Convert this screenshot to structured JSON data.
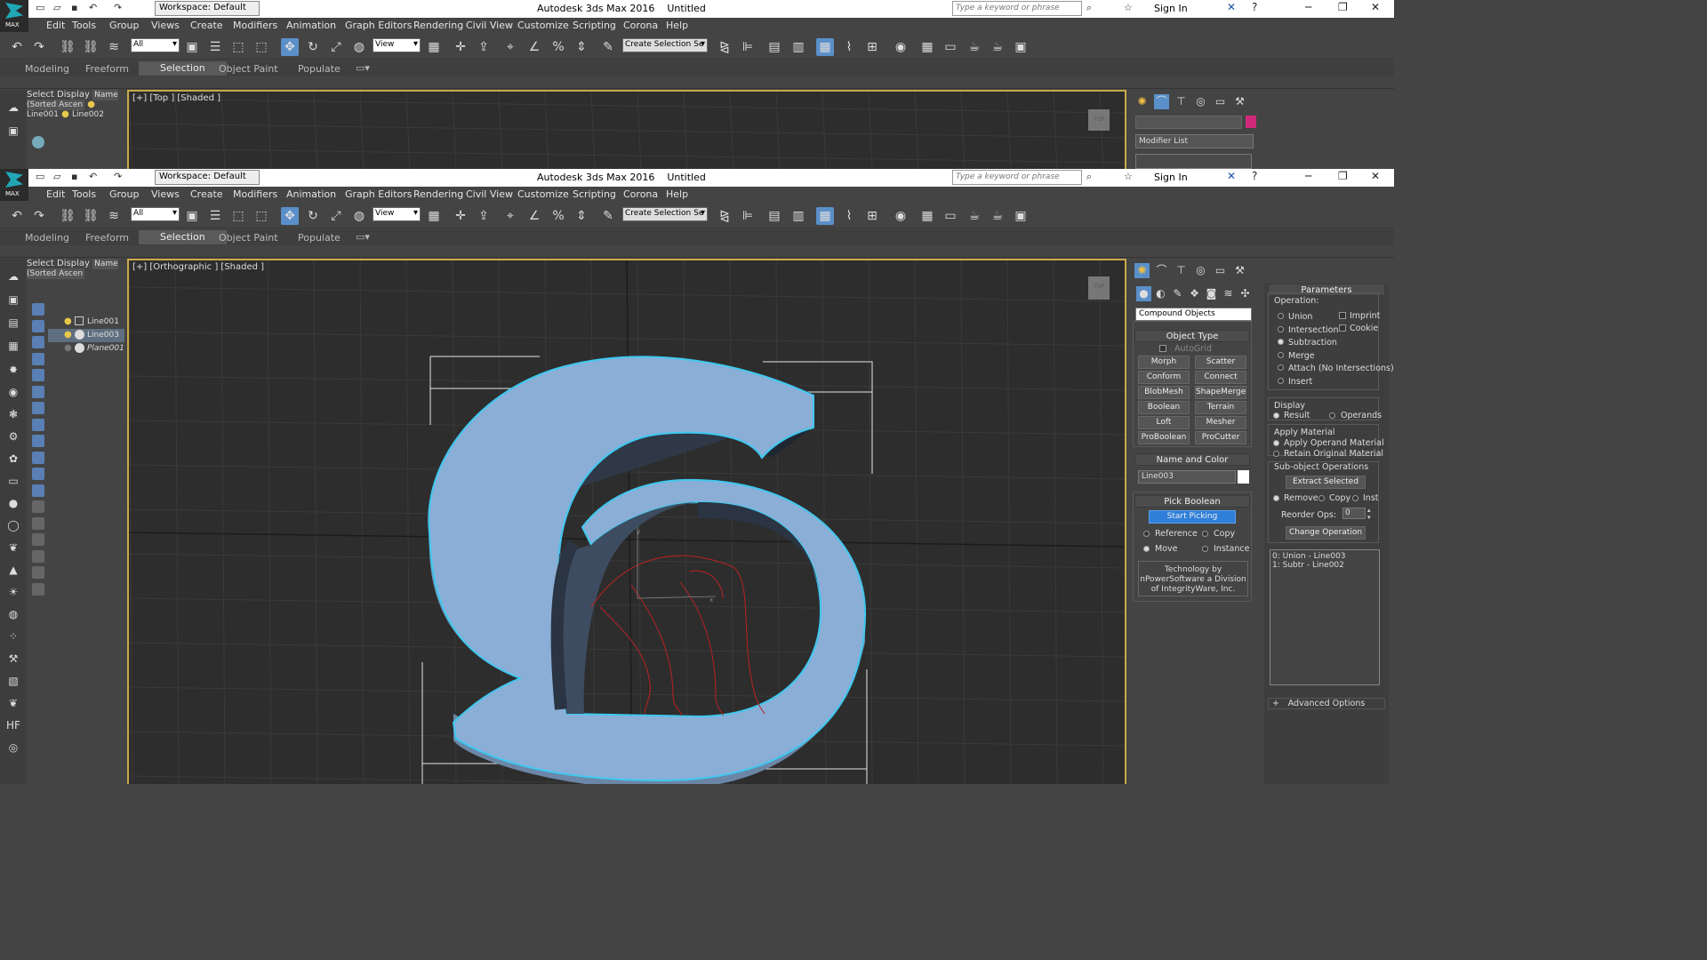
{
  "app": {
    "title": "Autodesk 3ds Max 2016",
    "doc": "Untitled",
    "logo_text": "MAX",
    "workspace": "Workspace: Default",
    "search_placeholder": "Type a keyword or phrase",
    "sign_in": "Sign In"
  },
  "menu": [
    "Edit",
    "Tools",
    "Group",
    "Views",
    "Create",
    "Modifiers",
    "Animation",
    "Graph Editors",
    "Rendering",
    "Civil View",
    "Customize",
    "Scripting",
    "Corona",
    "Help"
  ],
  "toolbar": {
    "filter": "All",
    "refcoord": "View",
    "named_selection": "Create Selection Se"
  },
  "ribbon": {
    "tabs": [
      "Modeling",
      "Freeform",
      "Selection",
      "Object Paint",
      "Populate"
    ],
    "active": "Selection"
  },
  "scene_explorer": {
    "tabs": [
      "Select",
      "Display"
    ],
    "column": "Name (Sorted Ascen",
    "top_items": [
      "Line001",
      "Line002"
    ],
    "items": [
      "Line001",
      "Line003",
      "Plane001"
    ]
  },
  "viewports": {
    "top": "[+] [Top ] [Shaded ]",
    "bottom": "[+] [Orthographic ] [Shaded ]",
    "viewcube": "TOP"
  },
  "modify_top": {
    "modifier_list": "Modifier List",
    "object_color": "#d0287a"
  },
  "create_panel": {
    "category": "Compound Objects",
    "object_type_title": "Object Type",
    "autogrid": "AutoGrid",
    "buttons": [
      "Morph",
      "Scatter",
      "Conform",
      "Connect",
      "BlobMesh",
      "ShapeMerge",
      "Boolean",
      "Terrain",
      "Loft",
      "Mesher",
      "ProBoolean",
      "ProCutter"
    ],
    "name_color_title": "Name and Color",
    "object_name": "Line003",
    "pick_boolean_title": "Pick Boolean",
    "start_picking": "Start Picking",
    "pick_options": [
      "Reference",
      "Copy",
      "Move",
      "Instance"
    ],
    "pick_selected": "Move",
    "credit": [
      "Technology by",
      "nPowerSoftware a Division",
      "of IntegrityWare, Inc."
    ]
  },
  "parameters": {
    "title": "Parameters",
    "operation_label": "Operation:",
    "operations": [
      "Union",
      "Intersection",
      "Subtraction",
      "Merge",
      "Attach (No Intersections)",
      "Insert"
    ],
    "operation_selected": "Subtraction",
    "checks": [
      "Imprint",
      "Cookie"
    ],
    "display_label": "Display",
    "display_options": [
      "Result",
      "Operands"
    ],
    "display_selected": "Result",
    "apply_material_label": "Apply Material",
    "material_options": [
      "Apply Operand Material",
      "Retain Original Material"
    ],
    "material_selected": "Apply Operand Material",
    "subobject_label": "Sub-object Operations",
    "extract_selected": "Extract Selected",
    "extract_modes": [
      "Remove",
      "Copy",
      "Inst"
    ],
    "extract_selected_mode": "Remove",
    "reorder_label": "Reorder Ops:",
    "reorder_value": "0",
    "change_operation": "Change Operation",
    "operands": [
      "0: Union - Line003",
      "1: Subtr - Line002"
    ],
    "advanced": "Advanced Options"
  },
  "colors": {
    "accent": "#5a8fc9",
    "viewport_border": "#c9a94a",
    "mesh": "#8aaed6",
    "selection_outline": "#3fc8f0"
  }
}
